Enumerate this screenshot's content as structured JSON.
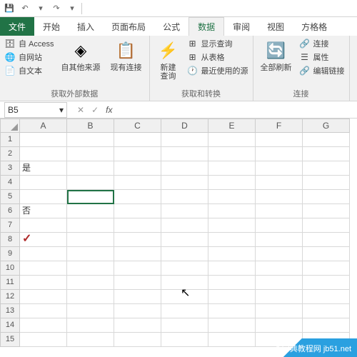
{
  "qat": {
    "save": "💾",
    "undo": "↶",
    "redo": "↷",
    "dropdown": "▾",
    "more": "▾"
  },
  "tabs": {
    "file": "文件",
    "home": "开始",
    "insert": "插入",
    "layout": "页面布局",
    "formulas": "公式",
    "data": "数据",
    "review": "审阅",
    "view": "视图",
    "design": "方格格"
  },
  "ribbon": {
    "group1": {
      "access": "自 Access",
      "web": "自网站",
      "text": "自文本",
      "other": "自其他来源",
      "existing": "现有连接",
      "label": "获取外部数据"
    },
    "group2": {
      "newquery": "新建\n查询",
      "showquery": "显示查询",
      "fromtable": "从表格",
      "recent": "最近使用的源",
      "label": "获取和转换"
    },
    "group3": {
      "refresh": "全部刷新",
      "connections": "连接",
      "properties": "属性",
      "editlinks": "编辑链接",
      "label": "连接"
    }
  },
  "namebox": {
    "ref": "B5"
  },
  "fx": {
    "cancel": "✕",
    "confirm": "✓",
    "label": "fx"
  },
  "columns": [
    "A",
    "B",
    "C",
    "D",
    "E",
    "F",
    "G"
  ],
  "rows_count": 15,
  "cells": {
    "A3": "是",
    "A6": "否",
    "A8": "✓"
  },
  "watermark": "查字典教程网 jb51.net",
  "chart_data": {
    "type": "table",
    "title": "Excel spreadsheet",
    "active_cell": "B5",
    "column_headers": [
      "A",
      "B",
      "C",
      "D",
      "E",
      "F",
      "G"
    ],
    "row_headers": [
      1,
      2,
      3,
      4,
      5,
      6,
      7,
      8,
      9,
      10,
      11,
      12,
      13,
      14,
      15
    ],
    "data": [
      {
        "cell": "A3",
        "value": "是"
      },
      {
        "cell": "A6",
        "value": "否"
      },
      {
        "cell": "A8",
        "value": "✓"
      }
    ]
  }
}
